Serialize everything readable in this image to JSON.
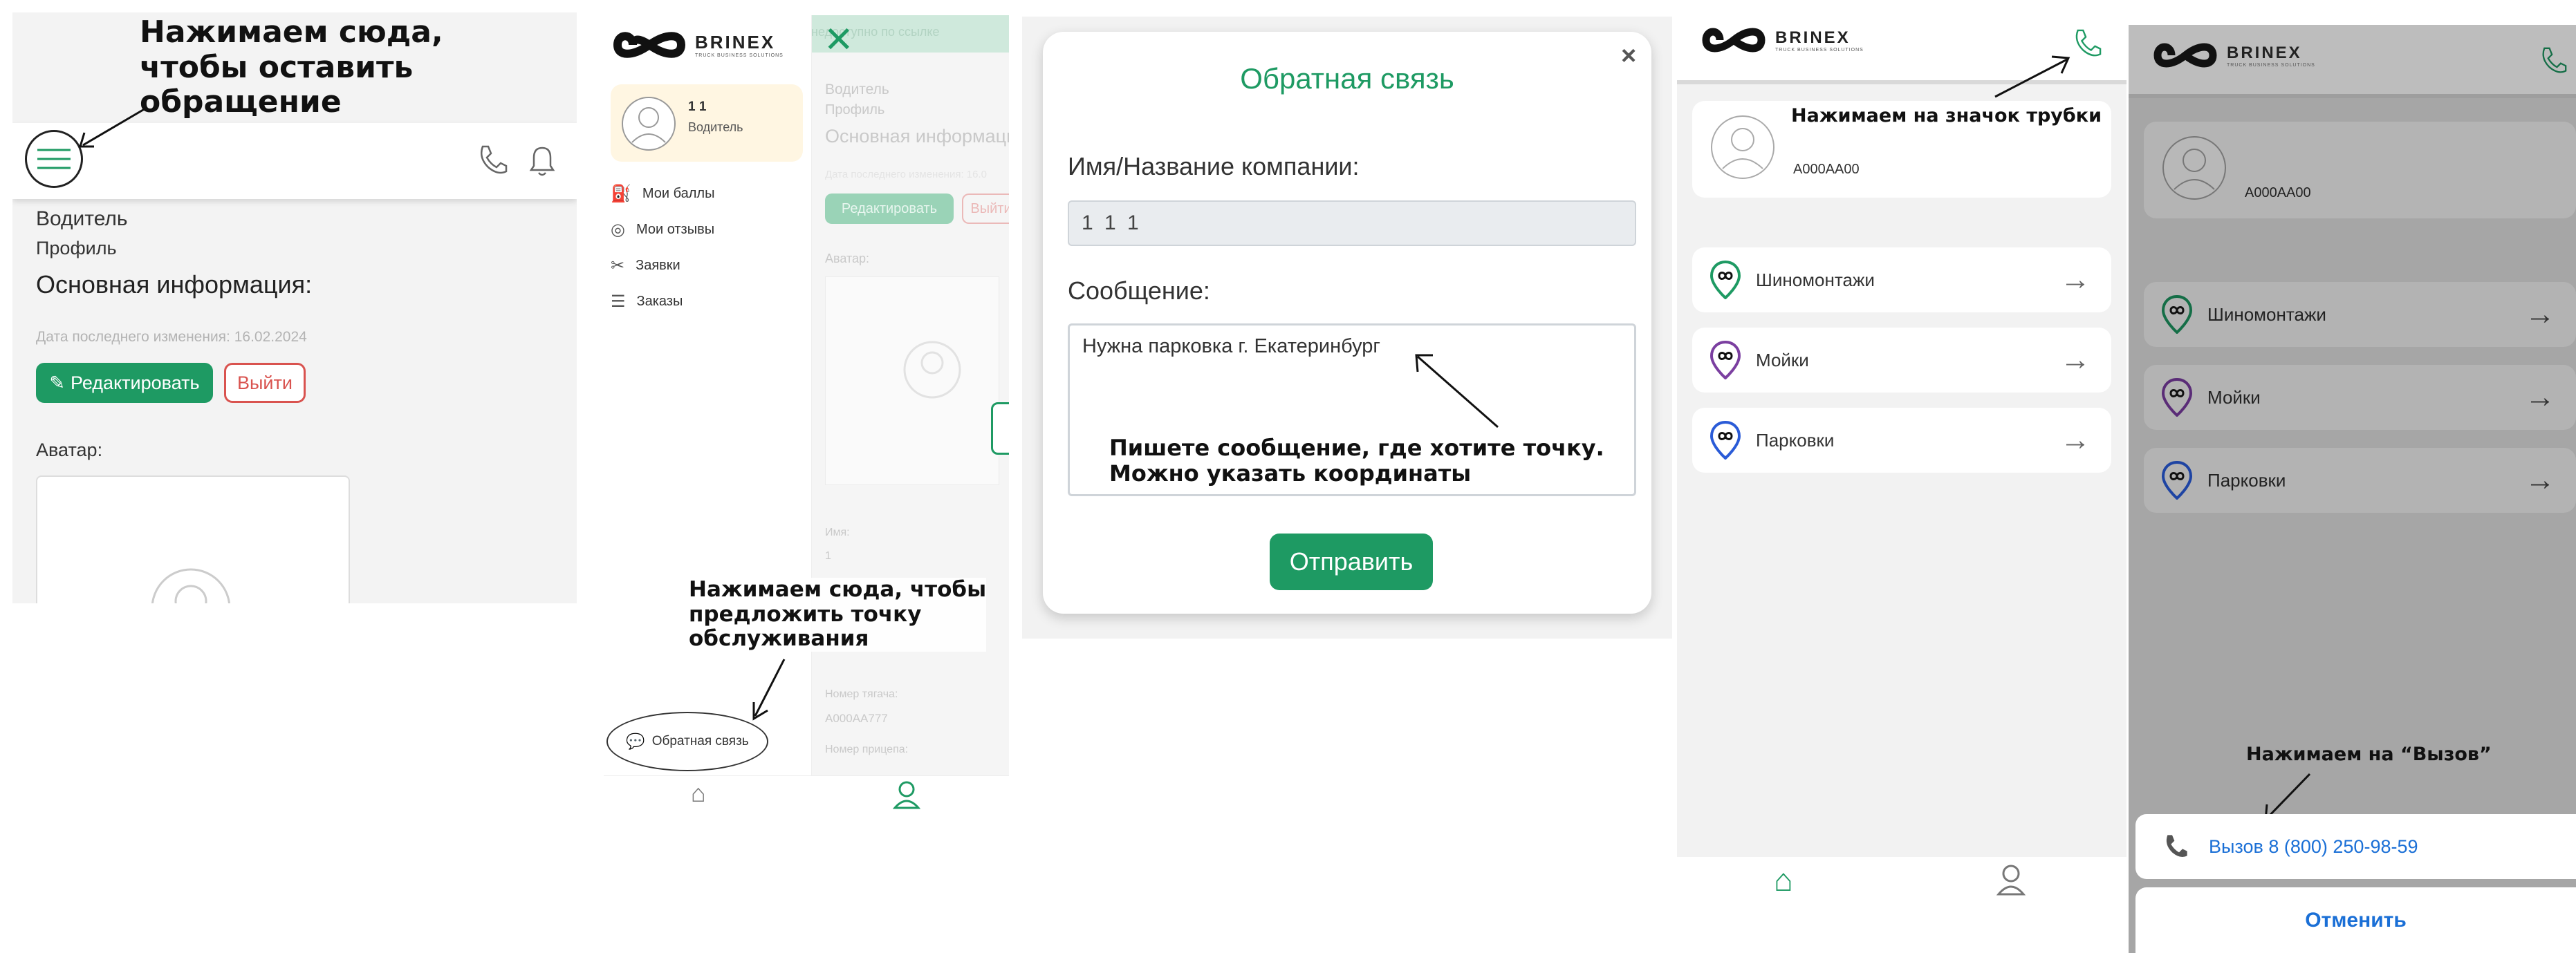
{
  "panel1": {
    "annotation": [
      "Нажимаем сюда,",
      "чтобы оставить",
      "обращение"
    ],
    "role": "Водитель",
    "profile": "Профиль",
    "section_title": "Основная информация:",
    "last_changed": "Дата последнего изменения: 16.02.2024",
    "edit_button": "Редактировать",
    "logout_button": "Выйти",
    "avatar_label": "Аватар:"
  },
  "panel2": {
    "brand": "BRINEX",
    "brand_sub": "TRUCK BUSINESS SOLUTIONS",
    "user_name": "1 1",
    "user_role": "Водитель",
    "menu": [
      {
        "label": "Мои баллы"
      },
      {
        "label": "Мои отзывы"
      },
      {
        "label": "Заявки"
      },
      {
        "label": "Заказы"
      }
    ],
    "feedback": "Обратная связь",
    "annotation": [
      "Нажимаем сюда, чтобы",
      "предложить точку",
      "обслуживания"
    ],
    "bg": {
      "banner": "недоступно по ссылке",
      "role": "Водитель",
      "profile": "Профиль",
      "title": "Основная информаци",
      "date": "Дата последнего изменения: 16.0",
      "edit": "Редактировать",
      "logout": "Выйти",
      "avatar": "Аватар:",
      "name_label": "Имя:",
      "name_value": "1",
      "plate_label": "Номер тягача:",
      "plate_value": "A000AA777",
      "trailer_label": "Номер прицепа:"
    }
  },
  "panel3": {
    "title": "Обратная связь",
    "name_label": "Имя/Название компании:",
    "name_value": "1 1 1",
    "message_label": "Сообщение:",
    "message_value": "Нужна парковка г. Екатеринбург",
    "annotation": [
      "Пишете сообщение, где хотите точку.",
      "Можно указать координаты"
    ],
    "send": "Отправить"
  },
  "panel4": {
    "brand": "BRINEX",
    "brand_sub": "TRUCK BUSINESS SOLUTIONS",
    "annotation": "Нажимаем на значок трубки",
    "plate": "A000AA00",
    "categories": [
      {
        "label": "Шиномонтажи",
        "color": "#1e9a63"
      },
      {
        "label": "Мойки",
        "color": "#7b3fa0"
      },
      {
        "label": "Парковки",
        "color": "#2a5bd7"
      }
    ]
  },
  "panel5": {
    "brand": "BRINEX",
    "brand_sub": "TRUCK BUSINESS SOLUTIONS",
    "plate": "A000AA00",
    "categories": [
      {
        "label": "Шиномонтажи"
      },
      {
        "label": "Мойки"
      },
      {
        "label": "Парковки"
      }
    ],
    "annotation": "Нажимаем на “Вызов”",
    "call": "Вызов 8 (800) 250-98-59",
    "cancel": "Отменить"
  },
  "colors": {
    "accent": "#1e9a63",
    "danger": "#d9534f",
    "link": "#1a6fd6"
  }
}
